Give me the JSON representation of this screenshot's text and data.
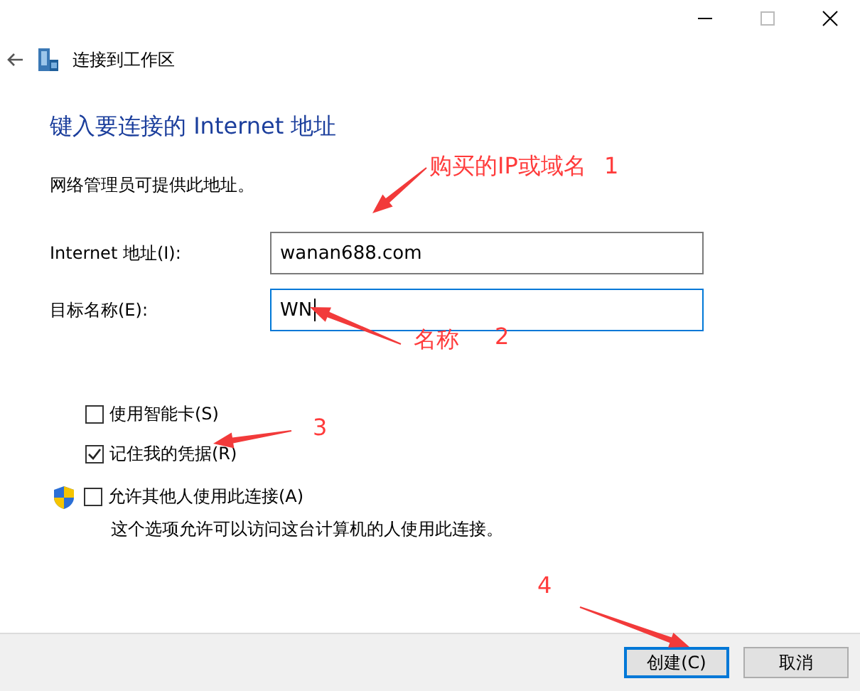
{
  "window": {
    "title": "连接到工作区"
  },
  "heading": "键入要连接的 Internet 地址",
  "description": "网络管理员可提供此地址。",
  "fields": [
    {
      "label": "Internet 地址(I):",
      "value": "wanan688.com",
      "focused": false
    },
    {
      "label": "目标名称(E):",
      "value": "WN",
      "focused": true
    }
  ],
  "options": [
    {
      "kind": "plain",
      "label": "使用智能卡(S)",
      "checked": false
    },
    {
      "kind": "plain",
      "label": "记住我的凭据(R)",
      "checked": true
    },
    {
      "kind": "shield",
      "label": "允许其他人使用此连接(A)",
      "checked": false
    }
  ],
  "option_note": "这个选项允许可以访问这台计算机的人使用此连接。",
  "buttons": [
    {
      "label": "创建(C)",
      "default": true
    },
    {
      "label": "取消",
      "default": false
    }
  ],
  "annotations": [
    {
      "text": "购买的IP或域名",
      "number": "1"
    },
    {
      "text": "名称",
      "number": "2"
    },
    {
      "number": "3"
    },
    {
      "number": "4"
    }
  ]
}
